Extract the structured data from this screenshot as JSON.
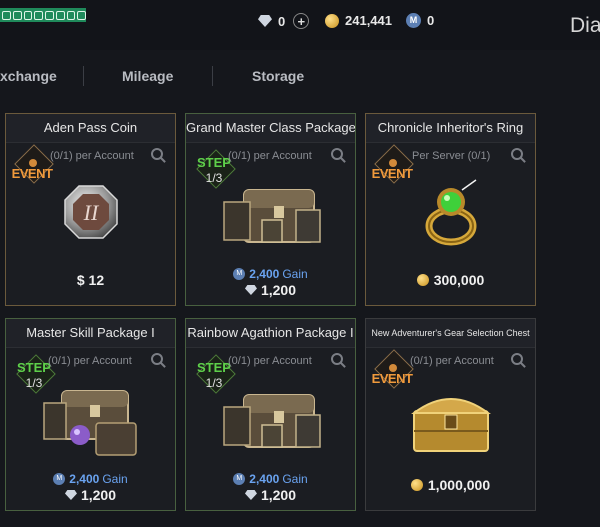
{
  "header": {
    "diamonds": "0",
    "adena": "241,441",
    "mileage": "0",
    "title": "Dia"
  },
  "tabs": [
    {
      "label": "xchange"
    },
    {
      "label": "Mileage"
    },
    {
      "label": "Storage"
    }
  ],
  "cards": [
    {
      "title": "Aden Pass Coin",
      "limit": "(0/1) per Account",
      "badge": "EVENT",
      "price": "$ 12"
    },
    {
      "title": "Grand Master Class Package I",
      "limit": "(0/1) per Account",
      "badge": "STEP",
      "step": "1/3",
      "gain_value": "2,400",
      "gain_label": "Gain",
      "diamond_price": "1,200"
    },
    {
      "title": "Chronicle Inheritor's Ring",
      "limit": "Per Server (0/1)",
      "badge": "EVENT",
      "adena_price": "300,000"
    },
    {
      "title": "Master Skill Package I",
      "limit": "(0/1) per Account",
      "badge": "STEP",
      "step": "1/3",
      "gain_value": "2,400",
      "gain_label": "Gain",
      "diamond_price": "1,200"
    },
    {
      "title": "Rainbow Agathion Package I",
      "limit": "(0/1) per Account",
      "badge": "STEP",
      "step": "1/3",
      "gain_value": "2,400",
      "gain_label": "Gain",
      "diamond_price": "1,200"
    },
    {
      "title": "New Adventurer's Gear Selection Chest",
      "limit": "(0/1) per Account",
      "badge": "EVENT",
      "adena_price": "1,000,000"
    }
  ],
  "colors": {
    "event": "#f09a3c",
    "step": "#5ed04a",
    "gain": "#6aa3f0",
    "background": "#15171c"
  },
  "icons": [
    "diamond-icon",
    "adena-coin-icon",
    "mileage-icon",
    "plus-icon",
    "zoom-icon"
  ]
}
